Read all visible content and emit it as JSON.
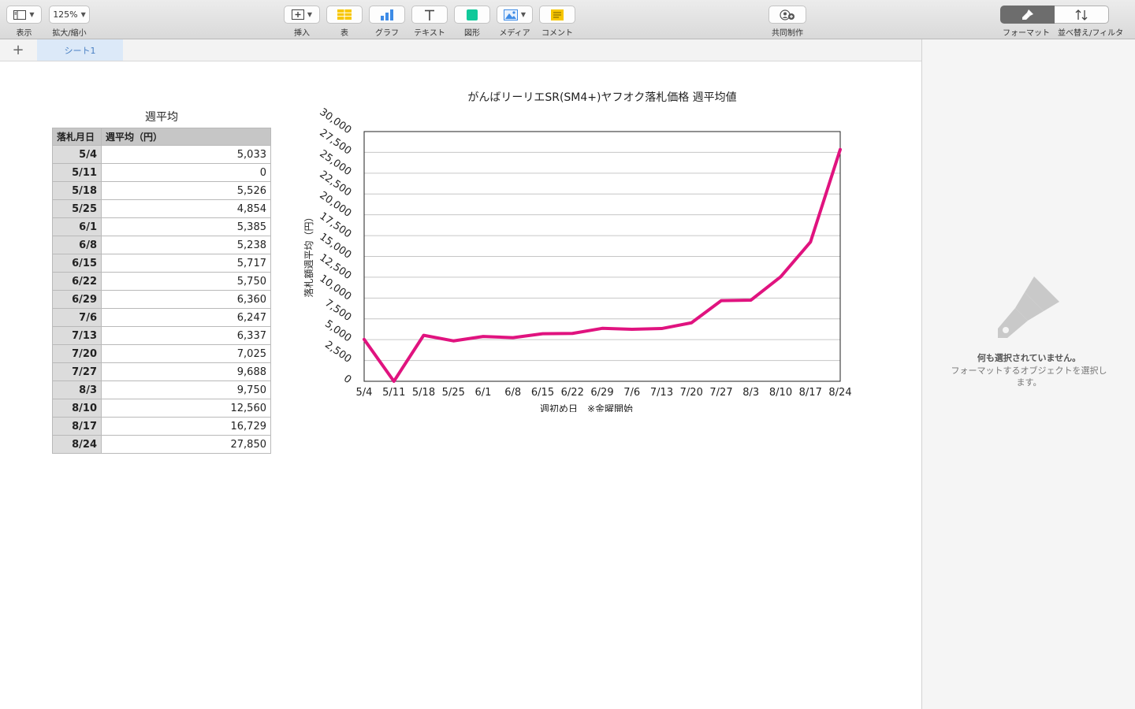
{
  "toolbar": {
    "view_label": "表示",
    "zoom_value": "125%",
    "zoom_label": "拡大/縮小",
    "insert_label": "挿入",
    "table_label": "表",
    "chart_label": "グラフ",
    "text_label": "テキスト",
    "shape_label": "図形",
    "media_label": "メディア",
    "comment_label": "コメント",
    "collab_label": "共同制作",
    "format_label": "フォーマット",
    "sort_label": "並べ替え/フィルタ",
    "icons": [
      "sidebar-view-icon",
      "insert-icon",
      "table-icon",
      "chart-icon",
      "text-icon",
      "shape-icon",
      "media-icon",
      "comment-icon",
      "collaborate-icon",
      "format-brush-icon",
      "sort-icon"
    ]
  },
  "tabs": {
    "add_label": "+",
    "sheets": [
      "シート1"
    ]
  },
  "table": {
    "title": "週平均",
    "headers": [
      "落札月日",
      "週平均（円）"
    ],
    "rows": [
      {
        "date": "5/4",
        "avg": "5,033"
      },
      {
        "date": "5/11",
        "avg": "0"
      },
      {
        "date": "5/18",
        "avg": "5,526"
      },
      {
        "date": "5/25",
        "avg": "4,854"
      },
      {
        "date": "6/1",
        "avg": "5,385"
      },
      {
        "date": "6/8",
        "avg": "5,238"
      },
      {
        "date": "6/15",
        "avg": "5,717"
      },
      {
        "date": "6/22",
        "avg": "5,750"
      },
      {
        "date": "6/29",
        "avg": "6,360"
      },
      {
        "date": "7/6",
        "avg": "6,247"
      },
      {
        "date": "7/13",
        "avg": "6,337"
      },
      {
        "date": "7/20",
        "avg": "7,025"
      },
      {
        "date": "7/27",
        "avg": "9,688"
      },
      {
        "date": "8/3",
        "avg": "9,750"
      },
      {
        "date": "8/10",
        "avg": "12,560"
      },
      {
        "date": "8/17",
        "avg": "16,729"
      },
      {
        "date": "8/24",
        "avg": "27,850"
      }
    ]
  },
  "chart_data": {
    "type": "line",
    "title": "がんばリーリエSR(SM4+)ヤフオク落札価格 週平均値",
    "xlabel": "週初め日　※金曜開始",
    "ylabel": "落札額週平均（円）",
    "categories": [
      "5/4",
      "5/11",
      "5/18",
      "5/25",
      "6/1",
      "6/8",
      "6/15",
      "6/22",
      "6/29",
      "7/6",
      "7/13",
      "7/20",
      "7/27",
      "8/3",
      "8/10",
      "8/17",
      "8/24"
    ],
    "series": [
      {
        "values": [
          5033,
          0,
          5526,
          4854,
          5385,
          5238,
          5717,
          5750,
          6360,
          6247,
          6337,
          7025,
          9688,
          9750,
          12560,
          16729,
          27850
        ]
      }
    ],
    "ylim": [
      0,
      30000
    ],
    "yticks": [
      "0",
      "2,500",
      "5,000",
      "7,500",
      "10,000",
      "12,500",
      "15,000",
      "17,500",
      "20,000",
      "22,500",
      "25,000",
      "27,500",
      "30,000"
    ],
    "grid": true,
    "line_color": "#e0137f",
    "legend": "none"
  },
  "panel": {
    "title": "何も選択されていません。",
    "subtitle": "フォーマットするオブジェクトを選択します。"
  }
}
